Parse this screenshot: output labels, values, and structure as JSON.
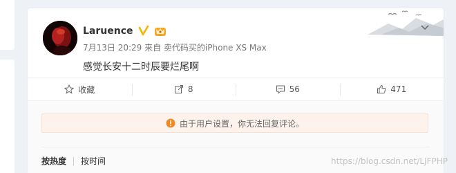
{
  "post": {
    "user_name": "Laruence",
    "meta": "7月13日 20:29 来自 卖代码买的iPhone XS Max",
    "content": "感觉长安十二时辰要烂尾啊"
  },
  "actions": {
    "favorite_label": "收藏",
    "repost_count": "8",
    "comment_count": "56",
    "like_count": "471"
  },
  "comments": {
    "notice": "由于用户设置，你无法回复评论。",
    "sort_hot": "按热度",
    "sort_time": "按时间"
  },
  "watermark": "https://blog.csdn.net/LJFPHP",
  "colors": {
    "verified": "#f7b500",
    "notice_icon": "#f08a24",
    "notice_bg": "#fdf3ec"
  }
}
